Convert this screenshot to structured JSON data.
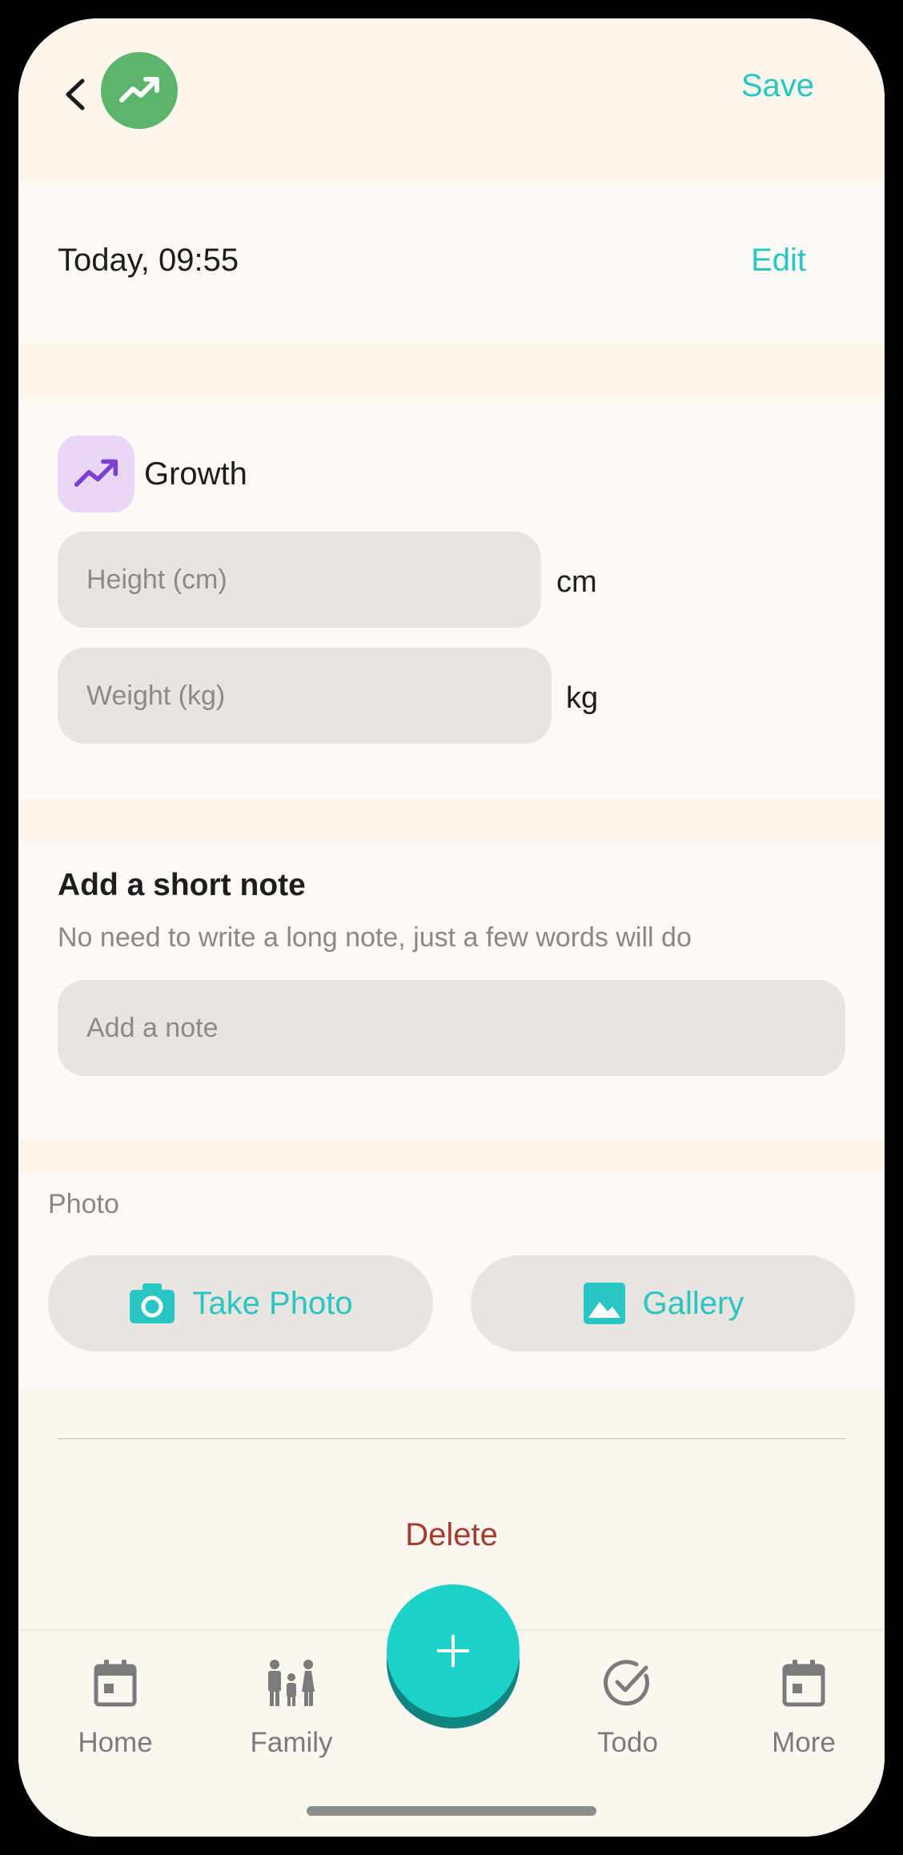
{
  "header": {
    "save_label": "Save"
  },
  "date_row": {
    "date_text": "Today, 09:55",
    "edit_label": "Edit"
  },
  "growth": {
    "label": "Growth",
    "height_placeholder": "Height (cm)",
    "height_unit": "cm",
    "weight_placeholder": "Weight (kg)",
    "weight_unit": "kg"
  },
  "note": {
    "title": "Add a short note",
    "subtitle": "No need to write a long note, just a few words will do",
    "placeholder": "Add a note"
  },
  "photo": {
    "label": "Photo",
    "take_photo_label": "Take Photo",
    "gallery_label": "Gallery"
  },
  "delete_label": "Delete",
  "nav": {
    "items": [
      {
        "label": "Home",
        "icon": "calendar-icon"
      },
      {
        "label": "Family",
        "icon": "family-icon"
      },
      {
        "label": "Todo",
        "icon": "check-circle-icon"
      },
      {
        "label": "More",
        "icon": "calendar-icon"
      }
    ],
    "fab_icon": "plus-icon"
  },
  "colors": {
    "accent": "#27c6c3",
    "fab": "#1dd2c9",
    "logo": "#5cb46a",
    "growth_icon_bg": "#e8d7f4",
    "growth_icon": "#7c3fd0",
    "delete": "#a63a2e"
  }
}
